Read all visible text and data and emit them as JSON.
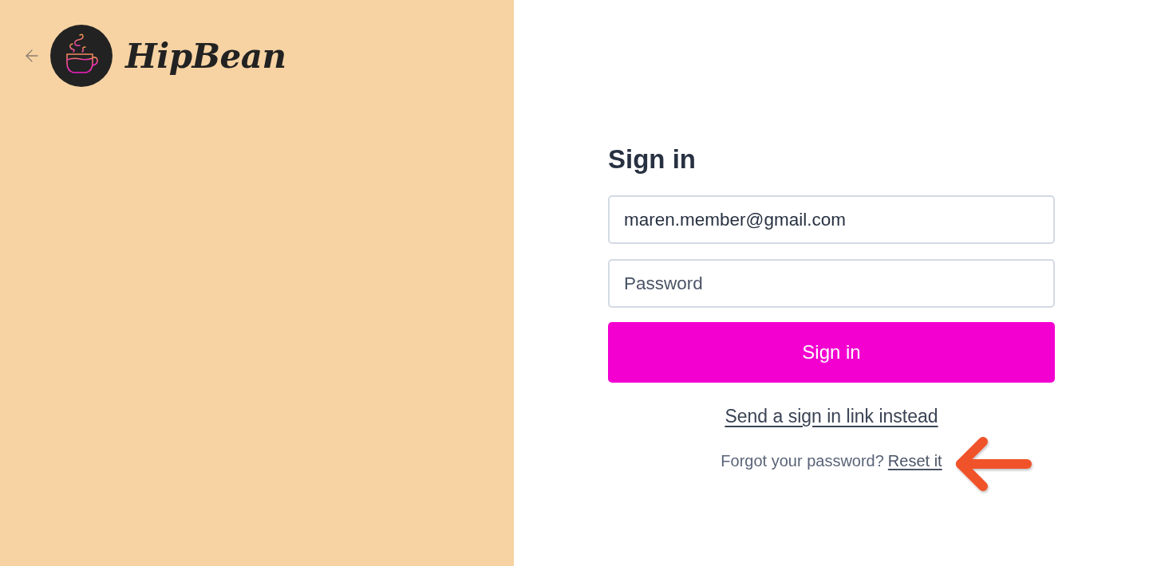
{
  "brand": {
    "name": "HipBean"
  },
  "form": {
    "title": "Sign in",
    "email": {
      "value": "maren.member@gmail.com"
    },
    "password": {
      "placeholder": "Password"
    },
    "submit": {
      "label": "Sign in"
    },
    "magic_link": {
      "label": "Send a sign in link instead"
    },
    "forgot": {
      "prompt": "Forgot your password?",
      "link": "Reset it"
    }
  }
}
